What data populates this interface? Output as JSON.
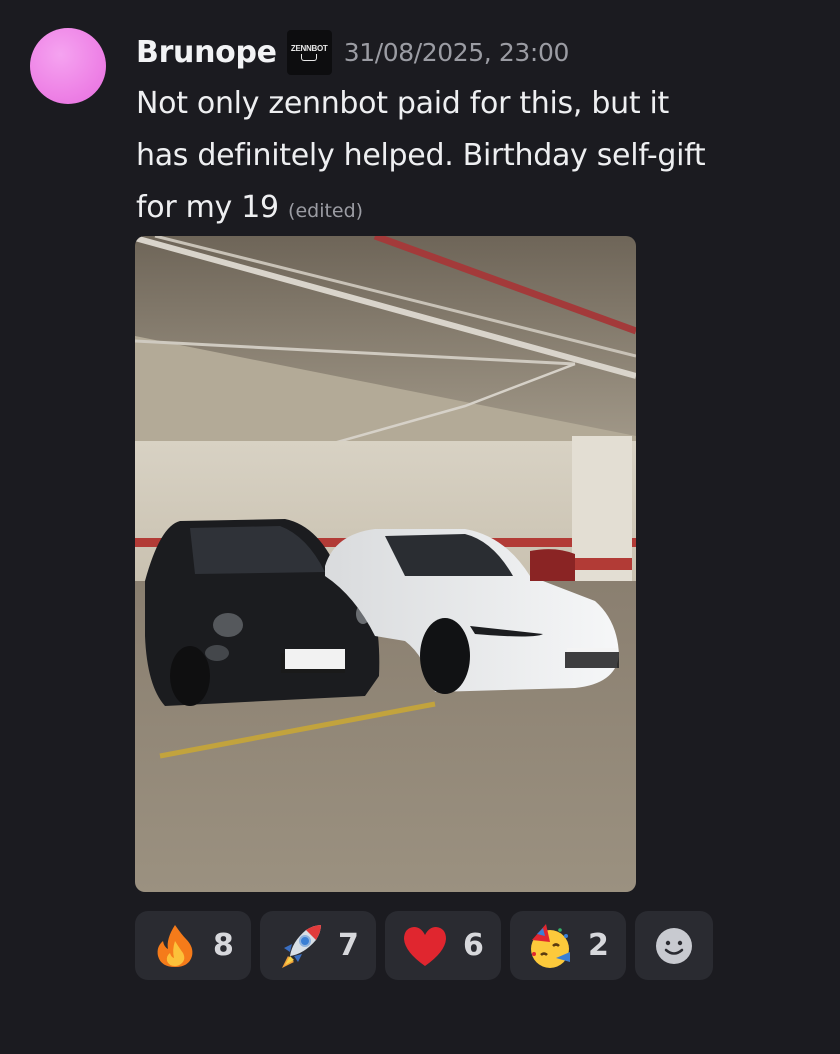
{
  "message": {
    "author": "Brunope",
    "tag_text": "ZENNBOT",
    "timestamp": "31/08/2025, 23:00",
    "content_lines": [
      "Not only zennbot paid for this, but it",
      "has definitely helped. Birthday self-gift",
      "for my 19"
    ],
    "edited_label": "(edited)",
    "avatar_color": "#ee82e6"
  },
  "attachment": {
    "kind": "photo",
    "subject": "black Abarth hatchback and white Tesla sedan parked in underground garage"
  },
  "reactions": [
    {
      "emoji": "fire-emoji",
      "count": "8"
    },
    {
      "emoji": "rocket-emoji",
      "count": "7"
    },
    {
      "emoji": "red-heart-emoji",
      "count": "6"
    },
    {
      "emoji": "partying-face-emoji",
      "count": "2"
    }
  ],
  "add_reaction_icon": "smiley-add-reaction-icon",
  "colors": {
    "background": "#1b1b20",
    "reaction_bg": "#2a2b31",
    "muted_text": "#9b9ca3"
  }
}
